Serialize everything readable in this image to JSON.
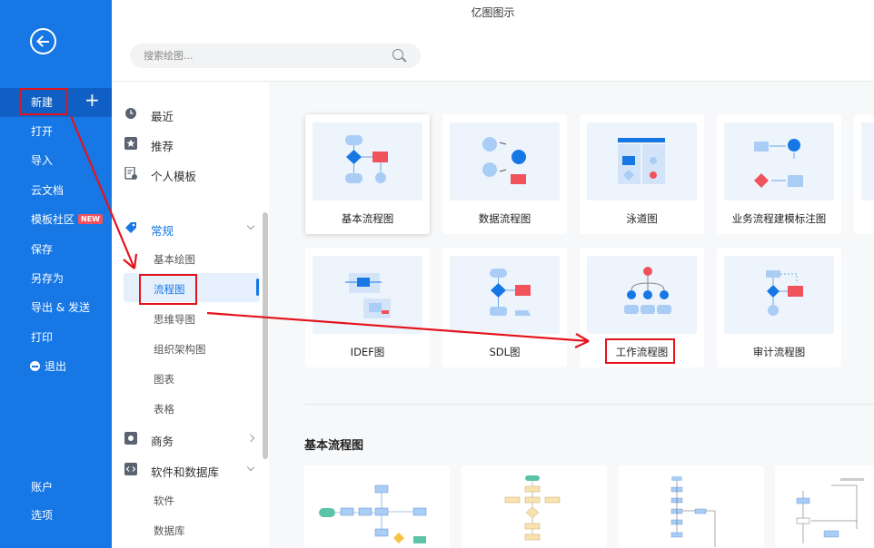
{
  "app": {
    "title": "亿图图示"
  },
  "sidebar": {
    "items": [
      {
        "label": "新建"
      },
      {
        "label": "打开"
      },
      {
        "label": "导入"
      },
      {
        "label": "云文档"
      },
      {
        "label": "模板社区"
      },
      {
        "label": "保存"
      },
      {
        "label": "另存为"
      },
      {
        "label": "导出 & 发送"
      },
      {
        "label": "打印"
      },
      {
        "label": "退出"
      }
    ],
    "new_badge": "NEW",
    "bottom_items": [
      {
        "label": "账户"
      },
      {
        "label": "选项"
      }
    ],
    "active_item": "新建"
  },
  "search": {
    "placeholder": "搜索绘图..."
  },
  "categories": {
    "top": [
      {
        "label": "最近",
        "icon": "clock-icon"
      },
      {
        "label": "推荐",
        "icon": "star-icon"
      },
      {
        "label": "个人模板",
        "icon": "personal-template-icon"
      }
    ],
    "groups": [
      {
        "label": "常规",
        "icon": "tag-icon",
        "expanded": true,
        "children": [
          "基本绘图",
          "流程图",
          "思维导图",
          "组织架构图",
          "图表",
          "表格"
        ]
      },
      {
        "label": "商务",
        "icon": "business-icon",
        "expanded": false,
        "children": []
      },
      {
        "label": "软件和数据库",
        "icon": "code-icon",
        "expanded": true,
        "children": [
          "软件",
          "数据库"
        ]
      }
    ],
    "selected": "流程图"
  },
  "templates": {
    "row1": [
      "基本流程图",
      "数据流程图",
      "泳道图",
      "业务流程建模标注图"
    ],
    "row2": [
      "IDEF图",
      "SDL图",
      "工作流程图",
      "审计流程图"
    ]
  },
  "section": {
    "title": "基本流程图"
  },
  "colors": {
    "sidebar": "#1677e5",
    "accent": "#1677e5",
    "highlight": "#e3141c"
  }
}
